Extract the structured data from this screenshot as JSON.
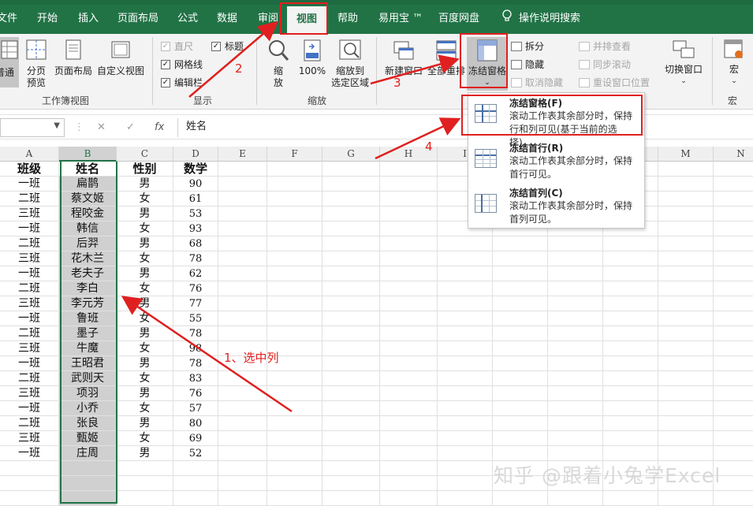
{
  "ribbon_tabs": [
    "文件",
    "开始",
    "插入",
    "页面布局",
    "公式",
    "数据",
    "审阅",
    "视图",
    "帮助",
    "易用宝 ™",
    "百度网盘",
    "操作说明搜索"
  ],
  "workbook_views": {
    "normal": "普通",
    "page_break": "分页\n预览",
    "page_layout": "页面布局",
    "custom_view": "自定义视图",
    "group_label": "工作簿视图"
  },
  "show_group": {
    "ruler": "直尺",
    "title": "标题",
    "gridlines": "网格线",
    "formula_bar": "编辑栏",
    "group_label": "显示"
  },
  "zoom_group": {
    "zoom": "缩\n放",
    "hundred": "100%",
    "zoom_selection": "缩放到\n选定区域",
    "group_label": "缩放"
  },
  "window_group": {
    "new_window": "新建窗口",
    "arrange_all": "全部重排",
    "freeze_panes": "冻结窗格",
    "split": "拆分",
    "hide": "隐藏",
    "unhide": "取消隐藏",
    "side_by_side": "并排查看",
    "sync_scroll": "同步滚动",
    "reset_position": "重设窗口位置",
    "switch_window": "切换窗口",
    "macro": "宏",
    "macro_group": "宏"
  },
  "formula_bar": {
    "cancel": "✕",
    "enter": "✓",
    "fx": "fx",
    "content": "姓名"
  },
  "columns": [
    "A",
    "B",
    "C",
    "D",
    "E",
    "F",
    "G",
    "H",
    "I",
    "J",
    "K",
    "L",
    "M",
    "N"
  ],
  "table_header": [
    "班级",
    "姓名",
    "性别",
    "数学"
  ],
  "table_rows": [
    [
      "一班",
      "扁鹊",
      "男",
      "90"
    ],
    [
      "二班",
      "蔡文姬",
      "女",
      "61"
    ],
    [
      "三班",
      "程咬金",
      "男",
      "53"
    ],
    [
      "一班",
      "韩信",
      "女",
      "93"
    ],
    [
      "二班",
      "后羿",
      "男",
      "68"
    ],
    [
      "三班",
      "花木兰",
      "女",
      "78"
    ],
    [
      "一班",
      "老夫子",
      "男",
      "62"
    ],
    [
      "二班",
      "李白",
      "女",
      "76"
    ],
    [
      "三班",
      "李元芳",
      "男",
      "77"
    ],
    [
      "一班",
      "鲁班",
      "女",
      "55"
    ],
    [
      "二班",
      "墨子",
      "男",
      "78"
    ],
    [
      "三班",
      "牛魔",
      "女",
      "98"
    ],
    [
      "一班",
      "王昭君",
      "男",
      "78"
    ],
    [
      "二班",
      "武则天",
      "女",
      "83"
    ],
    [
      "三班",
      "项羽",
      "男",
      "76"
    ],
    [
      "一班",
      "小乔",
      "女",
      "57"
    ],
    [
      "二班",
      "张良",
      "男",
      "80"
    ],
    [
      "三班",
      "甄姬",
      "女",
      "69"
    ],
    [
      "一班",
      "庄周",
      "男",
      "52"
    ]
  ],
  "freeze_menu": [
    {
      "title": "冻结窗格(F)",
      "desc": "滚动工作表其余部分时，保持行和列可见(基于当前的选择)。"
    },
    {
      "title": "冻结首行(R)",
      "desc": "滚动工作表其余部分时，保持首行可见。"
    },
    {
      "title": "冻结首列(C)",
      "desc": "滚动工作表其余部分时，保持首列可见。"
    }
  ],
  "annotations": {
    "step1": "1、选中列",
    "step2": "2",
    "step3": "3",
    "step4": "4"
  },
  "watermark": "知乎 @跟着小兔学Excel",
  "colors": {
    "excel_green": "#217346",
    "annotation_red": "#e02020",
    "selection_gray": "#d0d0d0"
  }
}
